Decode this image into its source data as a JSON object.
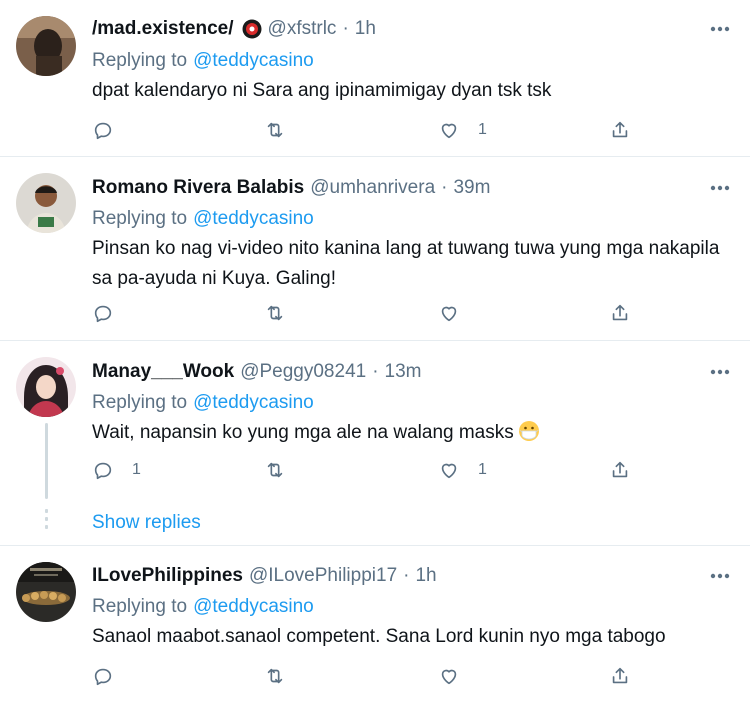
{
  "tweets": [
    {
      "name": "/mad.existence/",
      "handle": "@xfstrlc",
      "time": "1h",
      "replying_label": "Replying to",
      "replying_to": "@teddycasino",
      "text": "dpat kalendaryo ni Sara ang ipinamimigay dyan tsk tsk",
      "like_count": "1"
    },
    {
      "name": "Romano Rivera Balabis",
      "handle": "@umhanrivera",
      "time": "39m",
      "replying_label": "Replying to",
      "replying_to": "@teddycasino",
      "text": "Pinsan ko nag vi-video nito kanina lang at tuwang tuwa yung mga nakapila sa pa-ayuda ni Kuya. Galing!"
    },
    {
      "name": "Manay___Wook",
      "handle": "@Peggy08241",
      "time": "13m",
      "replying_label": "Replying to",
      "replying_to": "@teddycasino",
      "text": "Wait, napansin ko yung mga ale na walang masks",
      "emoji": "mask-face-emoji",
      "reply_count": "1",
      "like_count": "1",
      "show_replies": "Show replies"
    },
    {
      "name": "ILovePhilippines",
      "handle": "@ILovePhilippi17",
      "time": "1h",
      "replying_label": "Replying to",
      "replying_to": "@teddycasino",
      "text": "Sanaol maabot.sanaol competent. Sana Lord kunin nyo mga tabogo"
    }
  ],
  "separator": "·",
  "colors": {
    "link": "#1d9bf0",
    "muted": "#5b7083",
    "divider": "#e6ecf0"
  },
  "icons": [
    "reply-icon",
    "retweet-icon",
    "like-icon",
    "share-icon",
    "more-icon"
  ]
}
